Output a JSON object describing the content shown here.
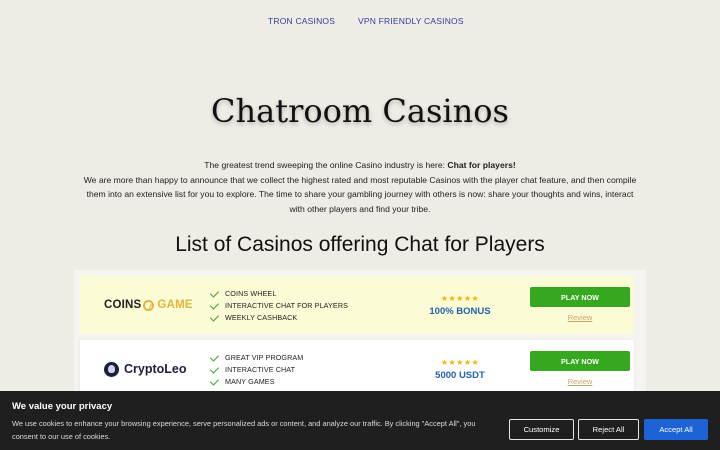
{
  "nav": {
    "items": [
      {
        "label": "TRON CASINOS"
      },
      {
        "label": "VPN FRIENDLY CASINOS"
      }
    ]
  },
  "page": {
    "title": "Chatroom Casinos",
    "intro_lead": "The greatest trend sweeping the online Casino industry is here: ",
    "intro_bold": "Chat for players!",
    "intro_body": "We are more than happy to announce that we collect the highest rated and most reputable Casinos with the player chat feature, and then compile them into an extensive list for you to explore. The time to share your gambling journey with others is now: share your thoughts and wins, interact with other players and find your tribe.",
    "list_heading": "List of Casinos offering Chat for Players"
  },
  "casinos": [
    {
      "logo_text_a": "COINS",
      "logo_text_b": "GAME",
      "features": [
        "COINS WHEEL",
        "INTERACTIVE CHAT FOR PLAYERS",
        "WEEKLY CASHBACK"
      ],
      "stars": "★★★★★",
      "bonus": "100% BONUS",
      "play_label": "PLAY NOW",
      "review_label": "Review"
    },
    {
      "logo_text": "CryptoLeo",
      "features": [
        "GREAT VIP PROGRAM",
        "INTERACTIVE CHAT",
        "MANY GAMES"
      ],
      "stars": "★★★★★",
      "bonus": "5000 USDT",
      "play_label": "PLAY NOW",
      "review_label": "Review"
    }
  ],
  "cookie": {
    "title": "We value your privacy",
    "text": "We use cookies to enhance your browsing experience, serve personalized ads or content, and analyze our traffic. By clicking \"Accept All\", you consent to our use of cookies.",
    "customize_label": "Customize",
    "reject_label": "Reject All",
    "accept_label": "Accept All"
  },
  "colors": {
    "background": "#efebe5",
    "nav_link": "#2f3e9e",
    "play_button": "#36a81f",
    "bonus_text": "#1f60b0",
    "stars": "#f0b400",
    "accept_button": "#1e63d6",
    "cookie_bar": "#1f1f1f",
    "highlight_card": "#fbfbd6"
  },
  "icons": {
    "coins_game_logo": "coin-swirl-icon",
    "cryptoleo_logo": "lion-head-icon",
    "feature_check": "check-icon",
    "rating": "star-icon"
  }
}
